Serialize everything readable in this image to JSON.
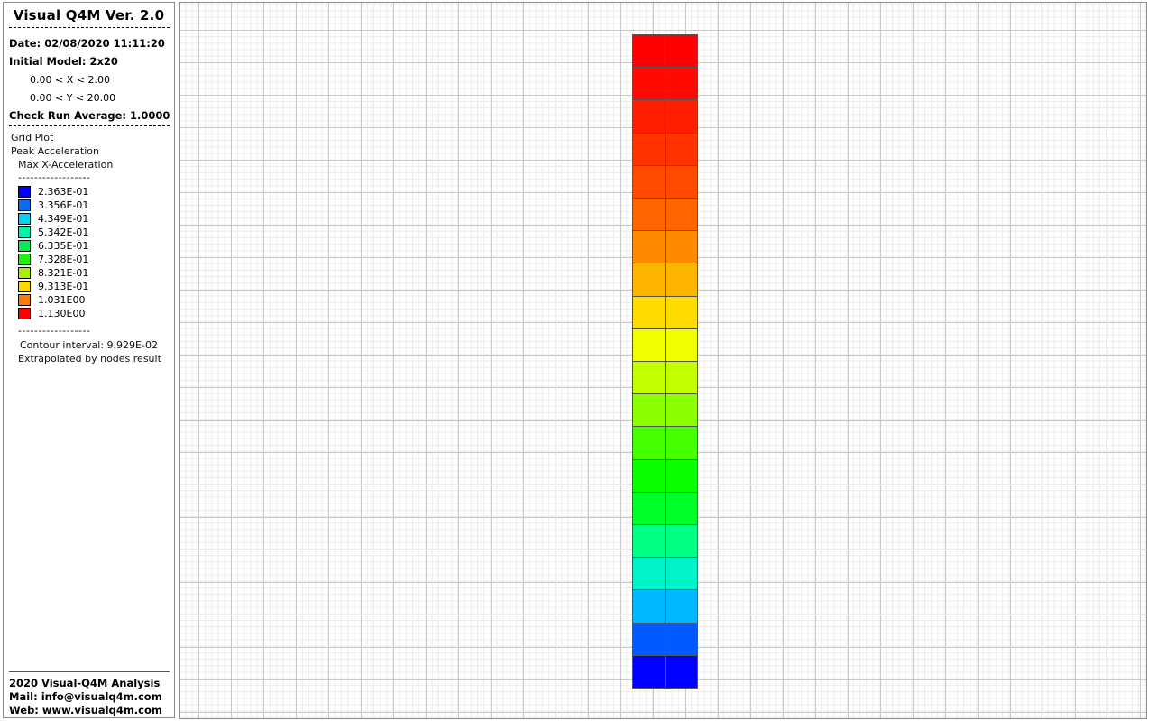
{
  "sidebar": {
    "title": "Visual Q4M Ver. 2.0",
    "date": "Date: 02/08/2020 11:11:20",
    "initial_model": "Initial Model: 2x20",
    "x_range": "0.00 < X < 2.00",
    "y_range": "0.00 < Y < 20.00",
    "check_run": "Check Run Average: 1.0000",
    "plot_type": "Grid Plot",
    "quantity": "Peak Acceleration",
    "component": "Max X-Acceleration",
    "dash_line": "------------------",
    "legend": [
      {
        "value": "2.363E-01",
        "color": "#0000ff"
      },
      {
        "value": "3.356E-01",
        "color": "#0a6cf5"
      },
      {
        "value": "4.349E-01",
        "color": "#00d2f5"
      },
      {
        "value": "5.342E-01",
        "color": "#00f5aa"
      },
      {
        "value": "6.335E-01",
        "color": "#08ea55"
      },
      {
        "value": "7.328E-01",
        "color": "#1ef20a"
      },
      {
        "value": "8.321E-01",
        "color": "#a8f000"
      },
      {
        "value": "9.313E-01",
        "color": "#ffd800"
      },
      {
        "value": "1.031E00",
        "color": "#ff7a00"
      },
      {
        "value": "1.130E00",
        "color": "#ff0000"
      }
    ],
    "contour_interval": "Contour interval: 9.929E-02",
    "extrapolated": "Extrapolated by nodes result",
    "footer": {
      "line1": "2020 Visual-Q4M Analysis",
      "line2": "Mail: info@visualq4m.com",
      "line3": "Web: www.visualq4m.com"
    }
  },
  "mesh": {
    "columns": 2,
    "rows": 20,
    "row_colors_top_to_bottom": [
      "#ff0000",
      "#ff0a00",
      "#ff1e00",
      "#ff3200",
      "#ff4a00",
      "#ff6400",
      "#ff8a00",
      "#ffb400",
      "#ffdc00",
      "#f0ff00",
      "#c4ff00",
      "#8cff00",
      "#46ff00",
      "#0aff00",
      "#00ff28",
      "#00ff82",
      "#00f2c8",
      "#00b8ff",
      "#005aff",
      "#0000ff"
    ]
  }
}
